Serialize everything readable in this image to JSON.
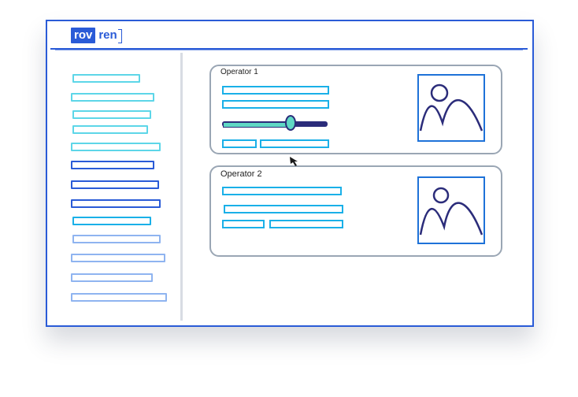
{
  "app": {
    "logo_part1": "rov",
    "logo_part2": "ren"
  },
  "cards": [
    {
      "title": "Operator 1"
    },
    {
      "title": "Operator 2"
    }
  ],
  "slider": {
    "value": 0.65
  },
  "icons": {
    "image_placeholder": "image-icon",
    "cursor": "mouse-pointer-icon"
  },
  "colors": {
    "accent": "#2a5bd7",
    "cyan": "#1ab0e8",
    "card_border": "#9aa6b4",
    "slider_dark": "#2b2c7a",
    "slider_light": "#5fd8c4"
  }
}
